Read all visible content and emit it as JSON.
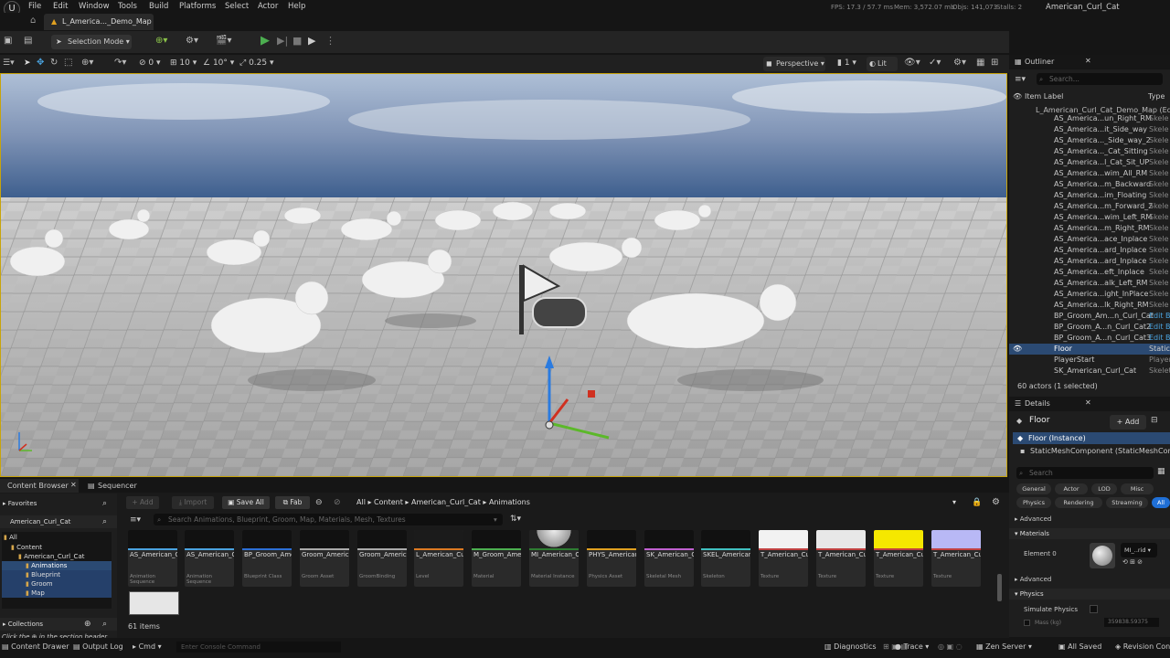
{
  "menu": [
    "File",
    "Edit",
    "Window",
    "Tools",
    "Build",
    "Platforms",
    "Select",
    "Actor",
    "Help"
  ],
  "stats": {
    "fps_label": "FPS:",
    "fps": "17.3",
    "ms": "57.7 ms",
    "mem_label": "Mem:",
    "mem": "3,572.07 mb",
    "objs_label": "Objs:",
    "objs": "141,073",
    "stalls_label": "Stalls:",
    "stalls": "2",
    "project": "American_Curl_Cat"
  },
  "tab": {
    "title": "L_America..._Demo_Map"
  },
  "toolbar": {
    "mode": "Selection Mode"
  },
  "viewport_bar": {
    "rot": "0",
    "snap_deg": "10",
    "snap_deg2": "10°",
    "scale": "0.25",
    "perspective": "Perspective",
    "lit": "Lit",
    "one": "1"
  },
  "outliner": {
    "title": "Outliner",
    "search": "Search...",
    "col_label": "Item Label",
    "col_type": "Type",
    "root": "L_American_Curl_Cat_Demo_Map (Ed",
    "items": [
      {
        "label": "AS_America...un_Right_RM",
        "type": "Skele"
      },
      {
        "label": "AS_America...it_Side_way",
        "type": "Skele"
      },
      {
        "label": "AS_America..._Side_way_2",
        "type": "Skele"
      },
      {
        "label": "AS_America..._Cat_Sitting",
        "type": "Skele"
      },
      {
        "label": "AS_America...l_Cat_Sit_UP",
        "type": "Skele"
      },
      {
        "label": "AS_America...wim_All_RM",
        "type": "Skele"
      },
      {
        "label": "AS_America...m_Backward",
        "type": "Skele"
      },
      {
        "label": "AS_America...im_Floating",
        "type": "Skele"
      },
      {
        "label": "AS_America...m_Forward_2",
        "type": "Skele"
      },
      {
        "label": "AS_America...wim_Left_RM",
        "type": "Skele"
      },
      {
        "label": "AS_America...m_Right_RM",
        "type": "Skele"
      },
      {
        "label": "AS_America...ace_Inplace",
        "type": "Skele"
      },
      {
        "label": "AS_America...ard_Inplace",
        "type": "Skele"
      },
      {
        "label": "AS_America...ard_Inplace",
        "type": "Skele"
      },
      {
        "label": "AS_America...eft_Inplace",
        "type": "Skele"
      },
      {
        "label": "AS_America...alk_Left_RM",
        "type": "Skele"
      },
      {
        "label": "AS_America...ight_InPlace",
        "type": "Skele"
      },
      {
        "label": "AS_America...lk_Right_RM",
        "type": "Skele"
      },
      {
        "label": "BP_Groom_Am...n_Curl_Cat",
        "type": "Edit B"
      },
      {
        "label": "BP_Groom_A...n_Curl_Cat2",
        "type": "Edit B"
      },
      {
        "label": "BP_Groom_A...n_Curl_Cat3",
        "type": "Edit B"
      },
      {
        "label": "Floor",
        "type": "Static"
      },
      {
        "label": "PlayerStart",
        "type": "Player"
      },
      {
        "label": "SK_American_Curl_Cat",
        "type": "Skelet"
      }
    ],
    "count": "60 actors (1 selected)"
  },
  "details": {
    "title": "Details",
    "actor": "Floor",
    "add": "+ Add",
    "instance": "Floor (Instance)",
    "component": "StaticMeshComponent (StaticMeshCor",
    "search": "Search",
    "filters1": [
      "General",
      "Actor",
      "LOD",
      "Misc"
    ],
    "filters2": [
      "Physics",
      "Rendering",
      "Streaming",
      "All"
    ],
    "advanced": "Advanced",
    "materials": "Materials",
    "element0": "Element 0",
    "mi_name": "MI_..rid",
    "advanced2": "Advanced",
    "physics": "Physics",
    "simulate": "Simulate Physics",
    "mass": "Mass (kg)",
    "mass_val": "359838.59375"
  },
  "content_browser": {
    "tab": "Content Browser",
    "tab2": "Sequencer",
    "add": "+ Add",
    "import": "Import",
    "save_all": "Save All",
    "fab": "Fab",
    "breadcrumbs": [
      "All",
      "Content",
      "American_Curl_Cat",
      "Animations"
    ],
    "favorites": "Favorites",
    "project_root": "American_Curl_Cat",
    "tree": [
      "All",
      "Content",
      "American_Curl_Cat",
      "Animations",
      "Blueprint",
      "Groom",
      "Map"
    ],
    "collections": "Collections",
    "collections_hint": "Click the",
    "collections_hint2": "in the section header",
    "search": "Search Animations, Blueprint, Groom, Map, Materials, Mesh, Textures",
    "count": "61 items",
    "assets": [
      {
        "name": "AS_American_Curl_Cat_Walk_Right_InPlace",
        "type": "Animation Sequence",
        "color": "#4aa3df"
      },
      {
        "name": "AS_American_Curl_Cat_Walk_Right_RM",
        "type": "Animation Sequence",
        "color": "#4aa3df"
      },
      {
        "name": "BP_Groom_American_Curl_Cat",
        "type": "Blueprint Class",
        "color": "#2d6fd6"
      },
      {
        "name": "Groom_American_Curl_Cat",
        "type": "Groom Asset",
        "color": "#aaaaaa"
      },
      {
        "name": "Groom_American_Curl_Cat_SK_",
        "type": "GroomBinding",
        "color": "#aaaaaa"
      },
      {
        "name": "L_American_Curl_Cat_Demo_Map",
        "type": "Level",
        "color": "#dd7a22"
      },
      {
        "name": "M_Groom_American_Curl_Cat",
        "type": "Material",
        "color": "#4caf50"
      },
      {
        "name": "MI_American_Curl_Cat",
        "type": "Material Instance",
        "color": "#2e7d32"
      },
      {
        "name": "PHYS_American_Curl_Cat",
        "type": "Physics Asset",
        "color": "#e0a020"
      },
      {
        "name": "SK_American_Curl_Cat",
        "type": "Skeletal Mesh",
        "color": "#c060d0"
      },
      {
        "name": "SKEL_American_Curl_Cat",
        "type": "Skeleton",
        "color": "#40c0c0"
      },
      {
        "name": "T_American_Curl_Cat_AO",
        "type": "Texture",
        "color": "#c04040"
      },
      {
        "name": "T_American_Curl_Cat_Diffuse",
        "type": "Texture",
        "color": "#c04040"
      },
      {
        "name": "T_American_Curl_Cat_Metallic_",
        "type": "Texture",
        "color": "#c04040"
      },
      {
        "name": "T_American_Curl_Cat_Normal",
        "type": "Texture",
        "color": "#c04040"
      }
    ]
  },
  "statusbar": {
    "drawer": "Content Drawer",
    "log": "Output Log",
    "cmd": "Cmd",
    "console": "Enter Console Command",
    "diagnostics": "Diagnostics",
    "trace": "Trace",
    "zen": "Zen Server",
    "saved": "All Saved",
    "revision": "Revision Con"
  }
}
